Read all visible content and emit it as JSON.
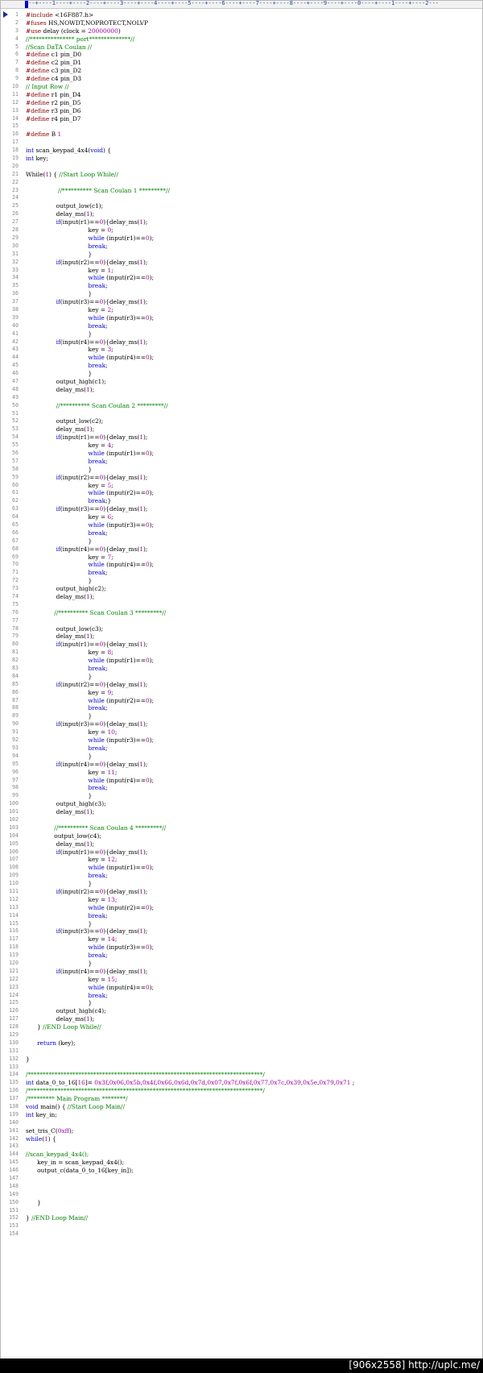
{
  "ruler": "---+----1----+----2----+----3----+----4----+----5----+----6----+----7----+----8----+----9----+----0----+----1----+----2---",
  "footer": "[906x2558] http://uplc.me/",
  "colors": {
    "preprocessor": "#8b0000",
    "comment": "#008000",
    "keyword": "#0000cc",
    "number": "#a000a0",
    "text": "#000000"
  },
  "lines": [
    "#include <16F887.h>",
    "#fuses HS,NOWDT,NOPROTECT,NOLVP",
    "#use delay (clock = 20000000)",
    "//*************** port**************//",
    "//Scan DaTA Coulan //",
    "#define c1 pin_D0",
    "#define c2 pin_D1",
    "#define c3 pin_D2",
    "#define c4 pin_D3",
    "// Input Row //",
    "#define r1 pin_D4",
    "#define r2 pin_D5",
    "#define r3 pin_D6",
    "#define r4 pin_D7",
    "",
    "#define B 1",
    "",
    "int scan_keypad_4x4(void) {",
    "int key;",
    "",
    "While(1) { //Start Loop While//",
    "",
    "                 //********** Scan Coulan 1 *********//",
    "",
    "                output_low(c1);",
    "                delay_ms(1);",
    "                if(input(r1)==0){delay_ms(1);",
    "                                 key = 0;",
    "                                 while (input(r1)==0);",
    "                                 break;",
    "                                 }",
    "                if(input(r2)==0){delay_ms(1);",
    "                                 key = 1;",
    "                                 while (input(r2)==0);",
    "                                 break;",
    "                                 }",
    "                if(input(r3)==0){delay_ms(1);",
    "                                 key = 2;",
    "                                 while (input(r3)==0);",
    "                                 break;",
    "                                 }",
    "                if(input(r4)==0){delay_ms(1);",
    "                                 key = 3;",
    "                                 while (input(r4)==0);",
    "                                 break;",
    "                                 }",
    "                output_high(c1);",
    "                delay_ms(1);",
    "",
    "                //********** Scan Coulan 2 *********//",
    "",
    "                output_low(c2);",
    "                delay_ms(1);",
    "                if(input(r1)==0){delay_ms(1);",
    "                                 key = 4;",
    "                                 while (input(r1)==0);",
    "                                 break;",
    "                                 }",
    "                if(input(r2)==0){delay_ms(1);",
    "                                 key = 5;",
    "                                 while (input(r2)==0);",
    "                                 break;}",
    "                if(input(r3)==0){delay_ms(1);",
    "                                 key = 6;",
    "                                 while (input(r3)==0);",
    "                                 break;",
    "                                 }",
    "                if(input(r4)==0){delay_ms(1);",
    "                                 key = 7;",
    "                                 while (input(r4)==0);",
    "                                 break;",
    "                                 }",
    "                output_high(c2);",
    "                delay_ms(1);",
    "",
    "               //********** Scan Coulan 3 *********//",
    "",
    "                output_low(c3);",
    "                delay_ms(1);",
    "                if(input(r1)==0){delay_ms(1);",
    "                                 key = 8;",
    "                                 while (input(r1)==0);",
    "                                 break;",
    "                                 }",
    "                if(input(r2)==0){delay_ms(1);",
    "                                 key = 9;",
    "                                 while (input(r2)==0);",
    "                                 break;",
    "                                 }",
    "                if(input(r3)==0){delay_ms(1);",
    "                                 key = 10;",
    "                                 while (input(r3)==0);",
    "                                 break;",
    "                                 }",
    "                if(input(r4)==0){delay_ms(1);",
    "                                 key = 11;",
    "                                 while (input(r4)==0);",
    "                                 break;",
    "                                 }",
    "                output_high(c3);",
    "                delay_ms(1);",
    "",
    "               //********** Scan Coulan 4 *********//",
    "               output_low(c4);",
    "                delay_ms(1);",
    "                if(input(r1)==0){delay_ms(1);",
    "                                 key = 12;",
    "                                 while (input(r1)==0);",
    "                                 break;",
    "                                 }",
    "                if(input(r2)==0){delay_ms(1);",
    "                                 key = 13;",
    "                                 while (input(r2)==0);",
    "                                 break;",
    "                                 }",
    "                if(input(r3)==0){delay_ms(1);",
    "                                 key = 14;",
    "                                 while (input(r3)==0);",
    "                                 break;",
    "                                 }",
    "                if(input(r4)==0){delay_ms(1);",
    "                                 key = 15;",
    "                                 while (input(r4)==0);",
    "                                 break;",
    "                                 }",
    "                output_high(c4);",
    "                delay_ms(1);",
    "      } //END Loop While//",
    "",
    "      return (key);",
    "",
    "}",
    "",
    "/*******************************************************************************/",
    "int data_0_to_16[16]= 0x3f,0x06,0x5b,0x4f,0x66,0x6d,0x7d,0x07,0x7f,0x6f,0x77,0x7c,0x39,0x5e,0x79,0x71 ;",
    "/*******************************************************************************/",
    "/********* Main Program ********/",
    "void main() { //Start Loop Main//",
    "int key_in;",
    "",
    "set_tris_C(0xff);",
    "while(1) {",
    "",
    "//scan_keypad_4x4();",
    "      key_in = scan_keypad_4x4();",
    "      output_c(data_0_to_16[key_in]);",
    "",
    "",
    "",
    "      }",
    "",
    "} //END Loop Main//",
    "",
    ""
  ]
}
